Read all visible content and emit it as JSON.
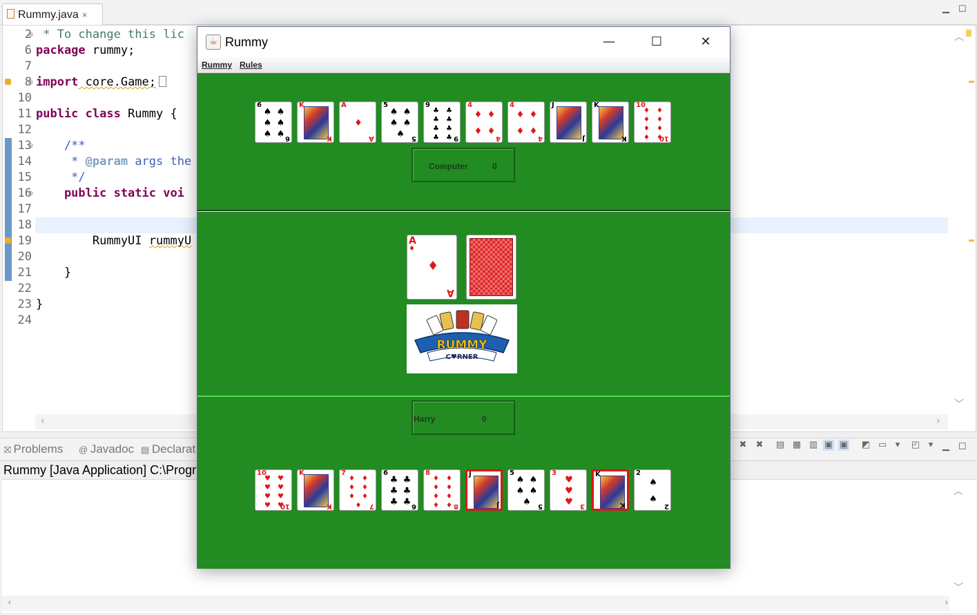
{
  "editor": {
    "tab_label": "Rummy.java",
    "close_glyph": "×",
    "line_numbers": [
      "2",
      "6",
      "7",
      "8",
      "10",
      "11",
      "12",
      "13",
      "14",
      "15",
      "16",
      "17",
      "18",
      "19",
      "20",
      "21",
      "22",
      "23",
      "24"
    ],
    "code": {
      "l2": " * To change this lic",
      "l6a": "package",
      "l6b": " rummy;",
      "l8a": "import",
      "l8b": " core.Game;",
      "l11a": "public class",
      "l11b": " Rummy {",
      "l13": "    /**",
      "l14a": "     * ",
      "l14b": "@param",
      "l14c": " args the",
      "l15": "     */",
      "l16a": "    public static",
      "l16b": " voi",
      "l19a": "        RummyUI ",
      "l19b": "rummyU",
      "l21": "    }",
      "l23": "}"
    }
  },
  "console": {
    "tabs": [
      "Problems",
      "Javadoc",
      "Declarat"
    ],
    "run_label": "Rummy [Java Application] C:\\Progra"
  },
  "window": {
    "title": "Rummy",
    "menu": [
      "Rummy",
      "Rules"
    ],
    "controls": {
      "minimize": "—",
      "maximize": "☐",
      "close": "✕"
    }
  },
  "game": {
    "computer": {
      "name": "Computer",
      "score": "0"
    },
    "player": {
      "name": "Harry",
      "score": "0"
    },
    "computer_hand": [
      {
        "rank": "6",
        "suit": "♠",
        "color": "black"
      },
      {
        "rank": "K",
        "suit": "♥",
        "color": "red",
        "face": true
      },
      {
        "rank": "A",
        "suit": "♦",
        "color": "red"
      },
      {
        "rank": "5",
        "suit": "♠",
        "color": "black"
      },
      {
        "rank": "9",
        "suit": "♣",
        "color": "black"
      },
      {
        "rank": "4",
        "suit": "♦",
        "color": "red"
      },
      {
        "rank": "4",
        "suit": "♦",
        "color": "red"
      },
      {
        "rank": "J",
        "suit": "♣",
        "color": "black",
        "face": true
      },
      {
        "rank": "K",
        "suit": "♣",
        "color": "black",
        "face": true
      },
      {
        "rank": "10",
        "suit": "♦",
        "color": "red"
      }
    ],
    "discard": {
      "rank": "A",
      "suit": "♦",
      "color": "red"
    },
    "player_hand": [
      {
        "rank": "10",
        "suit": "♥",
        "color": "red"
      },
      {
        "rank": "K",
        "suit": "♥",
        "color": "red",
        "face": true
      },
      {
        "rank": "7",
        "suit": "♦",
        "color": "red"
      },
      {
        "rank": "6",
        "suit": "♣",
        "color": "black"
      },
      {
        "rank": "8",
        "suit": "♦",
        "color": "red"
      },
      {
        "rank": "J",
        "suit": "♣",
        "color": "black",
        "face": true,
        "selected": true
      },
      {
        "rank": "5",
        "suit": "♠",
        "color": "black"
      },
      {
        "rank": "3",
        "suit": "♥",
        "color": "red"
      },
      {
        "rank": "K",
        "suit": "♣",
        "color": "black",
        "face": true,
        "selected": true
      },
      {
        "rank": "2",
        "suit": "♠",
        "color": "black"
      }
    ],
    "logo": {
      "line1": "RUMMY",
      "line2": "C♥RNER"
    }
  },
  "colors": {
    "table_green": "#228b22",
    "card_red": "#e01818",
    "selected_border": "#d81818"
  }
}
